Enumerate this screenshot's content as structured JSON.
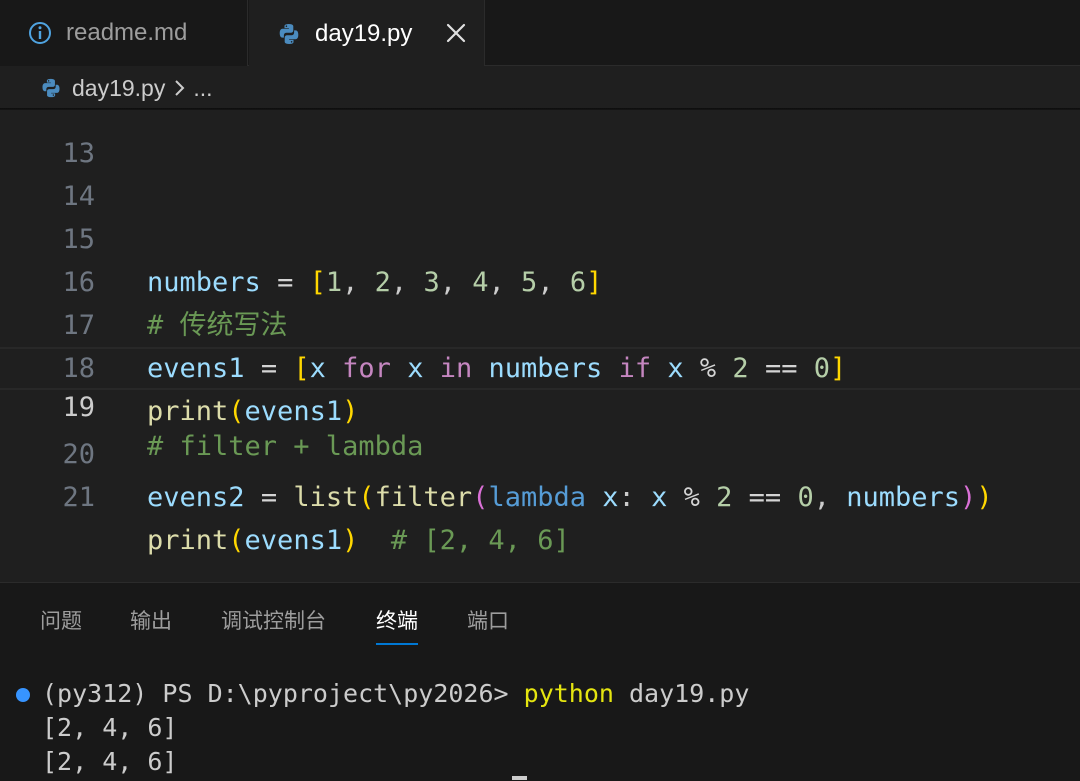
{
  "tabs": [
    {
      "label": "readme.md",
      "icon": "info-icon",
      "active": false
    },
    {
      "label": "day19.py",
      "icon": "python-icon",
      "active": true
    }
  ],
  "close_symbol": "×",
  "breadcrumb": {
    "file": "day19.py",
    "separator_icon": "chevron-right-icon",
    "more": "..."
  },
  "editor": {
    "current_line": 19,
    "partial_top_line_number": "13",
    "lines": [
      {
        "number": "14",
        "text": ""
      },
      {
        "number": "15",
        "text": "numbers = [1, 2, 3, 4, 5, 6]"
      },
      {
        "number": "16",
        "text": "# 传统写法"
      },
      {
        "number": "17",
        "text": "evens1 = [x for x in numbers if x % 2 == 0]"
      },
      {
        "number": "18",
        "text": "print(evens1)"
      },
      {
        "number": "19",
        "text": "# filter + lambda"
      },
      {
        "number": "20",
        "text": "evens2 = list(filter(lambda x: x % 2 == 0, numbers))"
      },
      {
        "number": "21",
        "text": "print(evens1)  # [2, 4, 6]"
      }
    ]
  },
  "panel": {
    "tabs": [
      {
        "label": "问题",
        "active": false
      },
      {
        "label": "输出",
        "active": false
      },
      {
        "label": "调试控制台",
        "active": false
      },
      {
        "label": "终端",
        "active": true
      },
      {
        "label": "端口",
        "active": false
      }
    ]
  },
  "terminal": {
    "prompt": "(py312) PS D:\\pyproject\\py2026> ",
    "command_exec": "python",
    "command_args": " day19.py",
    "output_lines": [
      "[2, 4, 6]",
      "[2, 4, 6]"
    ]
  },
  "colors": {
    "accent": "#0078d4",
    "terminal_dot": "#3794ff",
    "keyword": "#c586c0",
    "function": "#dcdcaa",
    "variable": "#9cdcfe",
    "comment": "#6a9955",
    "number": "#b5cea8"
  }
}
